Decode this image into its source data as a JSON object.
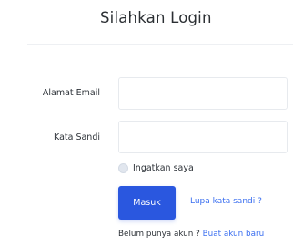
{
  "header": {
    "title": "Silahkan Login"
  },
  "form": {
    "email": {
      "label": "Alamat Email",
      "value": "",
      "placeholder": ""
    },
    "password": {
      "label": "Kata Sandi",
      "value": "",
      "placeholder": ""
    },
    "remember": {
      "label": "Ingatkan saya",
      "checked": false
    },
    "submit_label": "Masuk",
    "forgot_label": "Lupa kata sandi ?",
    "register_prompt": "Belum punya akun ? ",
    "register_link": "Buat akun baru"
  },
  "colors": {
    "primary": "#2a57df",
    "link": "#3b6ff0",
    "input_border": "#e7eaee"
  }
}
